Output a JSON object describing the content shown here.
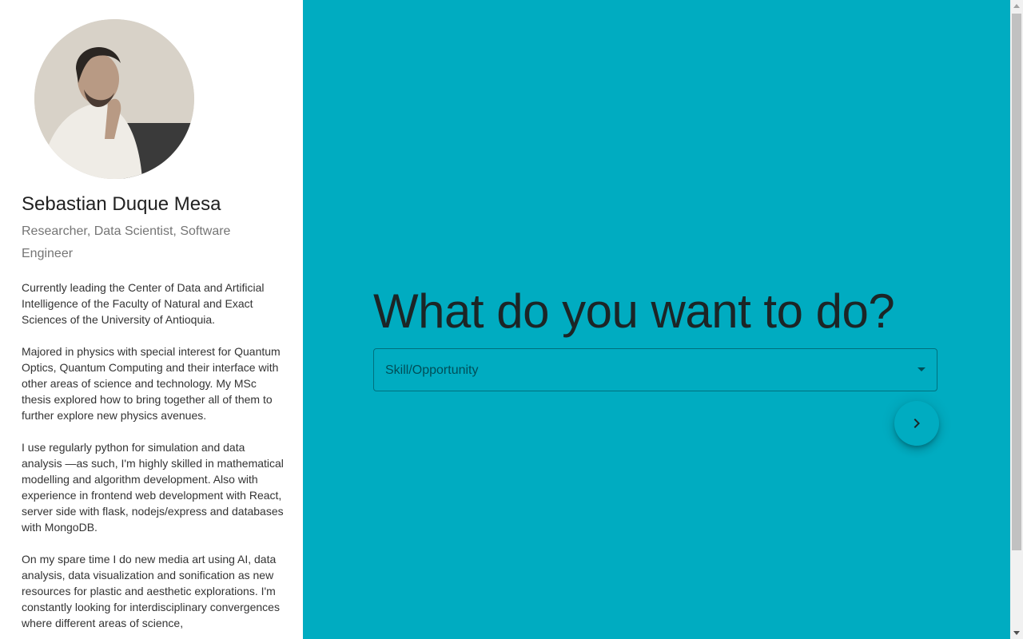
{
  "profile": {
    "name": "Sebastian Duque Mesa",
    "subtitle": "Researcher, Data Scientist, Software Engineer",
    "bio": [
      "Currently leading the Center of Data and Artificial Intelligence of the Faculty of Natural and Exact Sciences of the University of Antioquia.",
      "Majored in physics with special interest for Quantum Optics, Quantum Computing and their interface with other areas of science and technology. My MSc thesis explored how to bring together all of them to further explore new physics avenues.",
      "I use regularly python for simulation and data analysis —as such, I'm highly skilled in mathematical modelling and algorithm development. Also with experience in frontend web development with React, server side with flask, nodejs/express and databases with MongoDB.",
      "On my spare time I do new media art using AI, data analysis, data visualization and sonification as new resources for plastic and aesthetic explorations. I'm constantly looking for interdisciplinary convergences where different areas of science,"
    ]
  },
  "main": {
    "heading": "What do you want to do?",
    "select": {
      "label": "Skill/Opportunity"
    },
    "next_button_icon": "chevron-right-icon"
  },
  "colors": {
    "main_background": "#00acc1",
    "sidebar_background": "#ffffff"
  }
}
